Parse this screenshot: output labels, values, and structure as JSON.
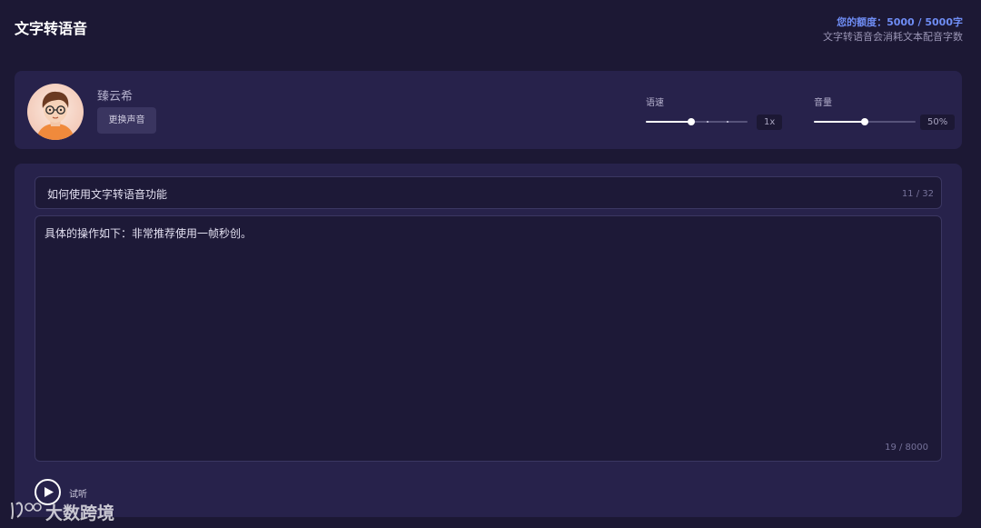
{
  "header": {
    "title": "文字转语音",
    "quota_line": "您的额度：5000 / 5000字",
    "quota_note": "文字转语音会消耗文本配音字数"
  },
  "voice": {
    "name": "臻云希",
    "change_button": "更换声音",
    "speed": {
      "label": "语速",
      "value_text": "1x",
      "level": 0.45
    },
    "volume": {
      "label": "音量",
      "value_text": "50%",
      "level": 0.5
    }
  },
  "editor": {
    "title_value": "如何使用文字转语音功能",
    "title_count": "11 / 32",
    "body_value": "具体的操作如下：非常推荐使用一帧秒创。",
    "body_count": "19 / 8000",
    "play_label": "试听"
  },
  "watermark": {
    "text": "大数跨境"
  },
  "colors": {
    "background": "#1c1834",
    "panel": "#27224b",
    "accent": "#6f8df5"
  }
}
